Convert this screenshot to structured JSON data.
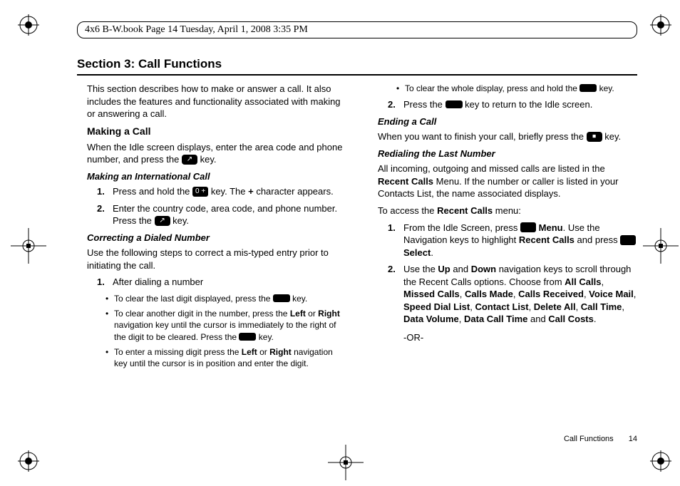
{
  "header": "4x6 B-W.book  Page 14  Tuesday, April 1, 2008  3:35 PM",
  "section_title": "Section 3: Call Functions",
  "left": {
    "intro": "This section describes how to make or answer a call. It also includes the features and functionality associated with making or answering a call.",
    "making_a_call_h": "Making a Call",
    "making_a_call_p_a": "When the Idle screen displays, enter the area code and phone number, and press the ",
    "making_a_call_p_b": " key.",
    "intl_h": "Making an International Call",
    "intl_1_a": "Press and hold the ",
    "intl_1_b": " key. The ",
    "intl_1_c": " character appears.",
    "intl_2": "Enter the country code, area code, and phone number.",
    "intl_press_a": "Press the ",
    "intl_press_b": " key.",
    "correct_h": "Correcting a Dialed Number",
    "correct_p": "Use the following steps to correct a mis-typed entry prior to initiating the call.",
    "correct_1": "After dialing a number",
    "b1_a": "To clear the last digit displayed, press the ",
    "b1_b": " key.",
    "b2_a": "To clear another digit in the number, press the ",
    "b2_b": " or ",
    "b2_c": " navigation key until the cursor is immediately to the right of the digit to be cleared. Press the ",
    "b2_d": " key.",
    "b3_a": "To enter a missing digit press the ",
    "b3_b": " or ",
    "b3_c": " navigation key until the cursor is in position and enter the digit.",
    "left_bold": "Left",
    "right_bold": "Right",
    "plus": "+"
  },
  "right": {
    "b4_a": "To clear the whole display, press and hold the ",
    "b4_b": " key.",
    "step2_a": "Press the ",
    "step2_b": " key to return to the Idle screen.",
    "end_h": "Ending a Call",
    "end_a": "When you want to finish your call, briefly press the ",
    "end_b": " key.",
    "redial_h": "Redialing the Last Number",
    "redial_p": "All incoming, outgoing and missed calls are listed in the ",
    "redial_p2": " Menu. If the number or caller is listed in your Contacts List, the name associated displays.",
    "recent_bold": "Recent Calls",
    "access_a": "To access the ",
    "access_b": " menu:",
    "r1_a": "From the Idle Screen, press ",
    "r1_b": ". Use the Navigation keys to highlight ",
    "r1_c": " and press ",
    "r1_d": ".",
    "menu_bold": "Menu",
    "recent_calls_bold": "Recent Calls",
    "select_bold": "Select",
    "r2_a": "Use the ",
    "r2_b": " and ",
    "r2_c": " navigation keys to scroll through the Recent Calls options. Choose from ",
    "r2_d": " and ",
    "r2_e": ".",
    "up": "Up",
    "down": "Down",
    "opts": [
      "All Calls",
      "Missed Calls",
      "Calls Made",
      "Calls Received",
      "Voice Mail",
      "Speed Dial List",
      "Contact List",
      "Delete All",
      "Call Time",
      "Data Volume",
      "Data Call Time"
    ],
    "opt_last": "Call Costs",
    "or": "-OR-"
  },
  "footer": {
    "label": "Call Functions",
    "page": "14"
  }
}
